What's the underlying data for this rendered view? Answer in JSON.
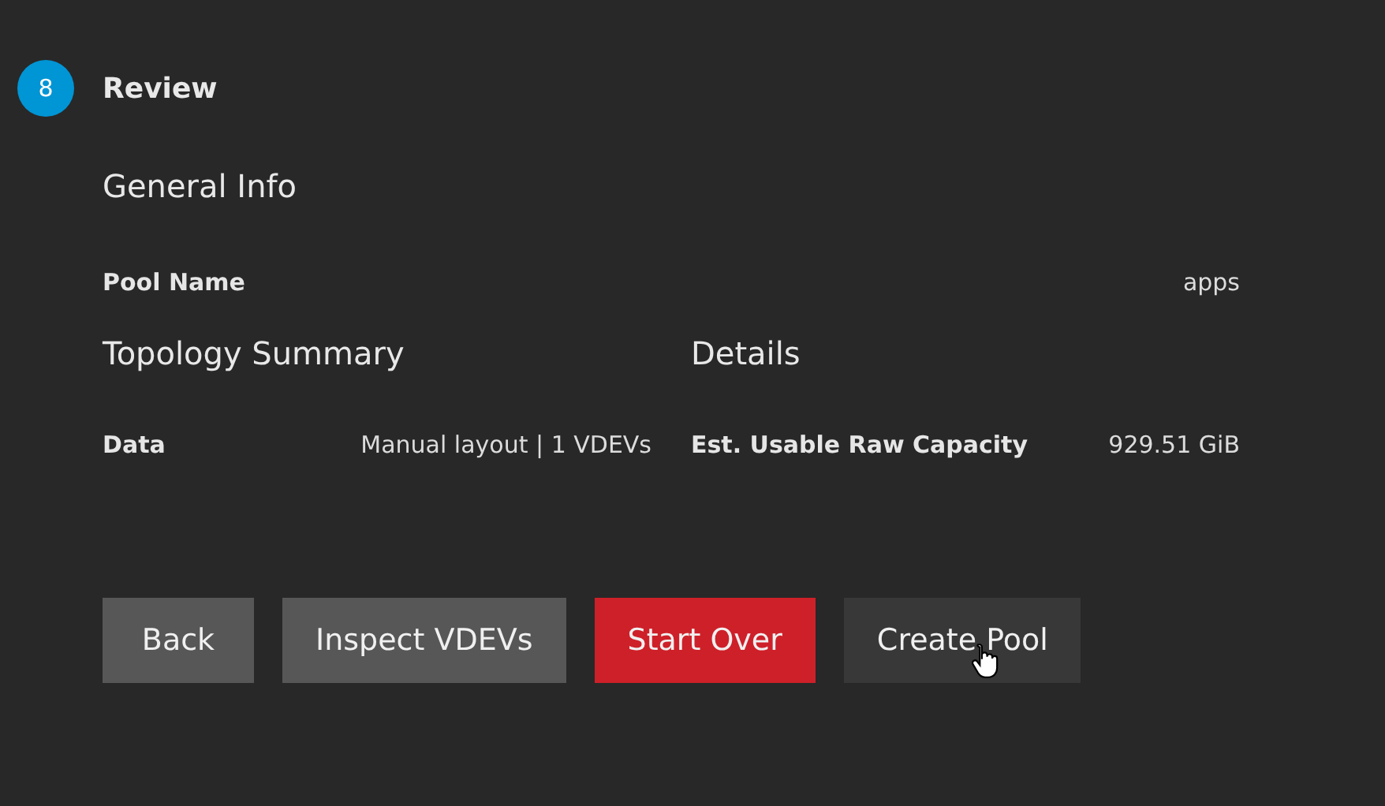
{
  "step": {
    "number": "8",
    "title": "Review"
  },
  "general_info": {
    "heading": "General Info",
    "rows": [
      {
        "label": "Pool Name",
        "value": "apps"
      }
    ]
  },
  "topology_summary": {
    "heading": "Topology Summary",
    "rows": [
      {
        "label": "Data",
        "value": "Manual layout | 1 VDEVs"
      }
    ]
  },
  "details": {
    "heading": "Details",
    "rows": [
      {
        "label": "Est. Usable Raw Capacity",
        "value": "929.51 GiB"
      }
    ]
  },
  "buttons": [
    {
      "label": "Back",
      "kind": "default",
      "hovered": false
    },
    {
      "label": "Inspect VDEVs",
      "kind": "default",
      "hovered": false
    },
    {
      "label": "Start Over",
      "kind": "warn",
      "hovered": false
    },
    {
      "label": "Create Pool",
      "kind": "flat",
      "hovered": true
    }
  ]
}
